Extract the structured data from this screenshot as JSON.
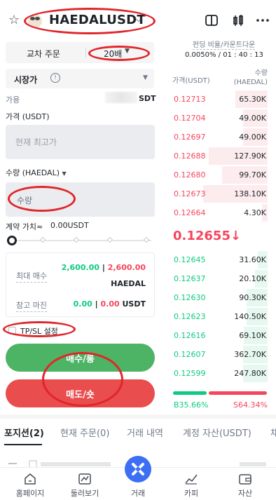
{
  "header": {
    "pair": "HAEDALUSDT",
    "icons": [
      "star-icon",
      "chevron-down-icon",
      "split-view-icon",
      "candlestick-icon",
      "more-icon"
    ]
  },
  "trade": {
    "margin_mode": "교차 주문",
    "leverage": "20배",
    "order_type": "시장가",
    "available_label": "가용",
    "available_unit": "SDT",
    "price_label": "가격 (USDT)",
    "price_placeholder": "현재 최고가",
    "qty_label": "수량 (HAEDAL)",
    "qty_placeholder": "수량",
    "contract_value_label": "계약 가치≈",
    "contract_value": "0.00USDT",
    "slider_percent": 0,
    "max_buy_label": "최대 매수",
    "max_buy_green": "2,600.00",
    "max_buy_red": "2,600.00",
    "max_buy_unit": "HAEDAL",
    "ref_margin_label": "참고 마진",
    "ref_margin_green": "0.00",
    "ref_margin_red": "0.00",
    "ref_margin_unit": "USDT",
    "tpsl_label": "TP/SL 설정",
    "buy_label": "매수/롱",
    "sell_label": "매도/숏"
  },
  "orderbook": {
    "funding_label": "펀딩 비율/카운트다운",
    "funding_value": "0.0050% / 01 : 40 : 13",
    "price_header": "가격(USDT)",
    "qty_header_1": "수량",
    "qty_header_2": "(HAEDAL)",
    "asks": [
      {
        "price": "0.12713",
        "qty": "65.30K",
        "depth": 0.34
      },
      {
        "price": "0.12704",
        "qty": "49.00K",
        "depth": 0.26
      },
      {
        "price": "0.12697",
        "qty": "49.00K",
        "depth": 0.26
      },
      {
        "price": "0.12688",
        "qty": "127.90K",
        "depth": 0.62
      },
      {
        "price": "0.12680",
        "qty": "99.70K",
        "depth": 0.48
      },
      {
        "price": "0.12673",
        "qty": "138.10K",
        "depth": 0.68
      },
      {
        "price": "0.12664",
        "qty": "4.30K",
        "depth": 0.06
      }
    ],
    "last_price": "0.12655↓",
    "bids": [
      {
        "price": "0.12645",
        "qty": "31.60K",
        "depth": 0.1
      },
      {
        "price": "0.12637",
        "qty": "20.10K",
        "depth": 0.13
      },
      {
        "price": "0.12630",
        "qty": "90.30K",
        "depth": 0.22
      },
      {
        "price": "0.12623",
        "qty": "140.50K",
        "depth": 0.22
      },
      {
        "price": "0.12616",
        "qty": "69.10K",
        "depth": 0.25
      },
      {
        "price": "0.12607",
        "qty": "362.70K",
        "depth": 0.26
      },
      {
        "price": "0.12599",
        "qty": "247.80K",
        "depth": 0.26
      }
    ],
    "buy_ratio": "B35.66%",
    "sell_ratio": "S64.34%",
    "buy_fraction": 0.3566
  },
  "tabs": [
    "포지션(2)",
    "현재 주문(0)",
    "거래 내역",
    "계정 자산(USDT)",
    "채"
  ],
  "nav": [
    "홈페이지",
    "둘러보기",
    "거래",
    "카피",
    "자산"
  ],
  "colors": {
    "buy": "#0ecb81",
    "sell": "#f6465d",
    "buy_button": "#4db365",
    "sell_button": "#e94d4d",
    "annotation": "#e0262b",
    "trade_fab": "#3d6ff5"
  }
}
